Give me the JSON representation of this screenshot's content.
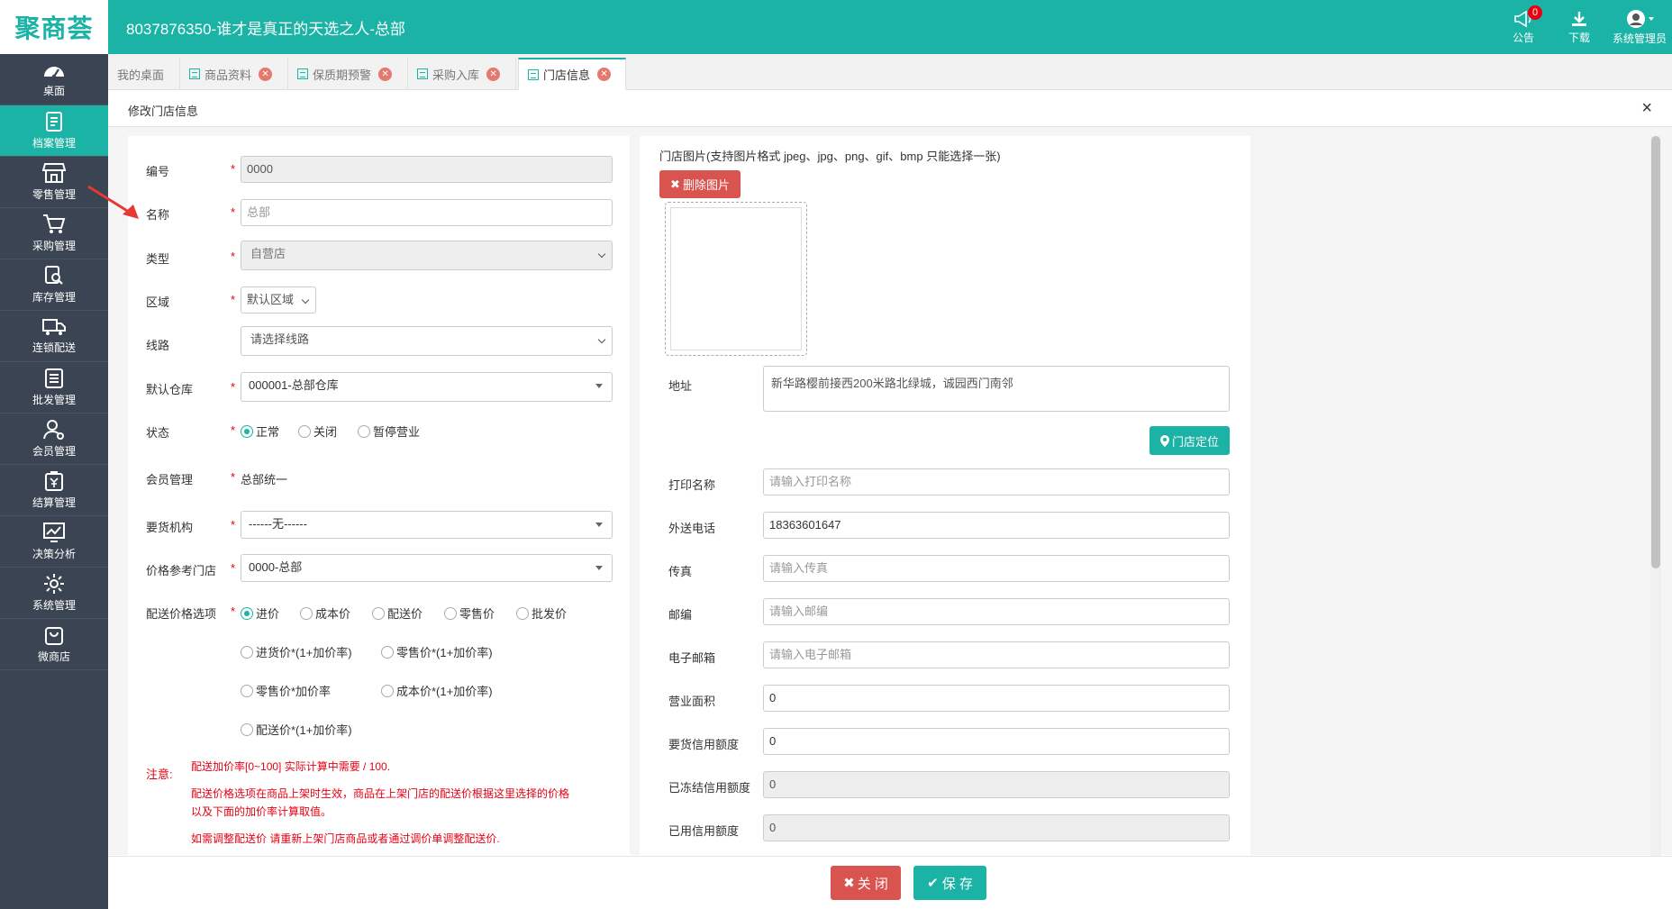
{
  "app": {
    "logo": "聚商荟",
    "title": "8037876350-谁才是真正的天选之人-总部"
  },
  "top_actions": {
    "notice_label": "公告",
    "notice_count": "0",
    "download_label": "下载",
    "user_label": "系统管理员"
  },
  "sidebar": {
    "items": [
      {
        "label": "桌面",
        "icon": "dashboard-icon"
      },
      {
        "label": "档案管理",
        "icon": "archive-icon"
      },
      {
        "label": "零售管理",
        "icon": "store-icon"
      },
      {
        "label": "采购管理",
        "icon": "cart-icon"
      },
      {
        "label": "库存管理",
        "icon": "inventory-icon"
      },
      {
        "label": "连锁配送",
        "icon": "truck-icon"
      },
      {
        "label": "批发管理",
        "icon": "wholesale-icon"
      },
      {
        "label": "会员管理",
        "icon": "member-icon"
      },
      {
        "label": "结算管理",
        "icon": "settlement-icon"
      },
      {
        "label": "决策分析",
        "icon": "chart-icon"
      },
      {
        "label": "系统管理",
        "icon": "gear-icon"
      },
      {
        "label": "微商店",
        "icon": "bag-icon"
      }
    ],
    "active_index": 1
  },
  "tabs": [
    {
      "label": "我的桌面",
      "closable": false
    },
    {
      "label": "商品资料",
      "closable": true
    },
    {
      "label": "保质期预警",
      "closable": true
    },
    {
      "label": "采购入库",
      "closable": true
    },
    {
      "label": "门店信息",
      "closable": true,
      "active": true
    }
  ],
  "panel": {
    "title": "修改门店信息",
    "close_symbol": "×"
  },
  "form_left": {
    "code": {
      "label": "编号",
      "value": "0000"
    },
    "name": {
      "label": "名称",
      "placeholder": "总部"
    },
    "type": {
      "label": "类型",
      "value": "自营店"
    },
    "region": {
      "label": "区域",
      "value": "默认区域"
    },
    "route": {
      "label": "线路",
      "value": "请选择线路"
    },
    "warehouse": {
      "label": "默认仓库",
      "value": "000001-总部仓库"
    },
    "status": {
      "label": "状态",
      "options": [
        "正常",
        "关闭",
        "暂停营业"
      ],
      "selected": "正常"
    },
    "member": {
      "label": "会员管理",
      "value": "总部统一"
    },
    "order_org": {
      "label": "要货机构",
      "value": "------无------"
    },
    "price_ref": {
      "label": "价格参考门店",
      "value": "0000-总部"
    },
    "delivery_price": {
      "label": "配送价格选项",
      "row1": [
        "进价",
        "成本价",
        "配送价",
        "零售价",
        "批发价"
      ],
      "row2": [
        "进货价*(1+加价率)",
        "零售价*(1+加价率)"
      ],
      "row3": [
        "零售价*加价率",
        "成本价*(1+加价率)"
      ],
      "row4": [
        "配送价*(1+加价率)"
      ],
      "selected": "进价"
    },
    "note_label": "注意:",
    "notes": [
      "配送加价率[0~100] 实际计算中需要 / 100.",
      "配送价格选项在商品上架时生效，商品在上架门店的配送价根据这里选择的价格",
      "以及下面的加价率计算取值。",
      "如需调整配送价 请重新上架门店商品或者通过调价单调整配送价."
    ]
  },
  "form_right": {
    "image_label": "门店图片(支持图片格式 jpeg、jpg、png、gif、bmp 只能选择一张)",
    "delete_image_button": "删除图片",
    "address": {
      "label": "地址",
      "value": "新华路樱前接西200米路北绿城，诚园西门南邻"
    },
    "locate_button": "门店定位",
    "print_name": {
      "label": "打印名称",
      "placeholder": "请输入打印名称"
    },
    "phone": {
      "label": "外送电话",
      "value": "18363601647"
    },
    "fax": {
      "label": "传真",
      "placeholder": "请输入传真"
    },
    "zip": {
      "label": "邮编",
      "placeholder": "请输入邮编"
    },
    "email": {
      "label": "电子邮箱",
      "placeholder": "请输入电子邮箱"
    },
    "area": {
      "label": "营业面积",
      "value": "0"
    },
    "credit_limit": {
      "label": "要货信用额度",
      "value": "0"
    },
    "frozen_credit": {
      "label": "已冻结信用额度",
      "value": "0"
    },
    "used_credit": {
      "label": "已用信用额度",
      "value": "0"
    }
  },
  "footer": {
    "close_button": "关 闭",
    "save_button": "保 存"
  },
  "colors": {
    "brand": "#1ab3a6",
    "sidebar": "#3a4452",
    "danger": "#d9534f",
    "required": "#e60012"
  }
}
